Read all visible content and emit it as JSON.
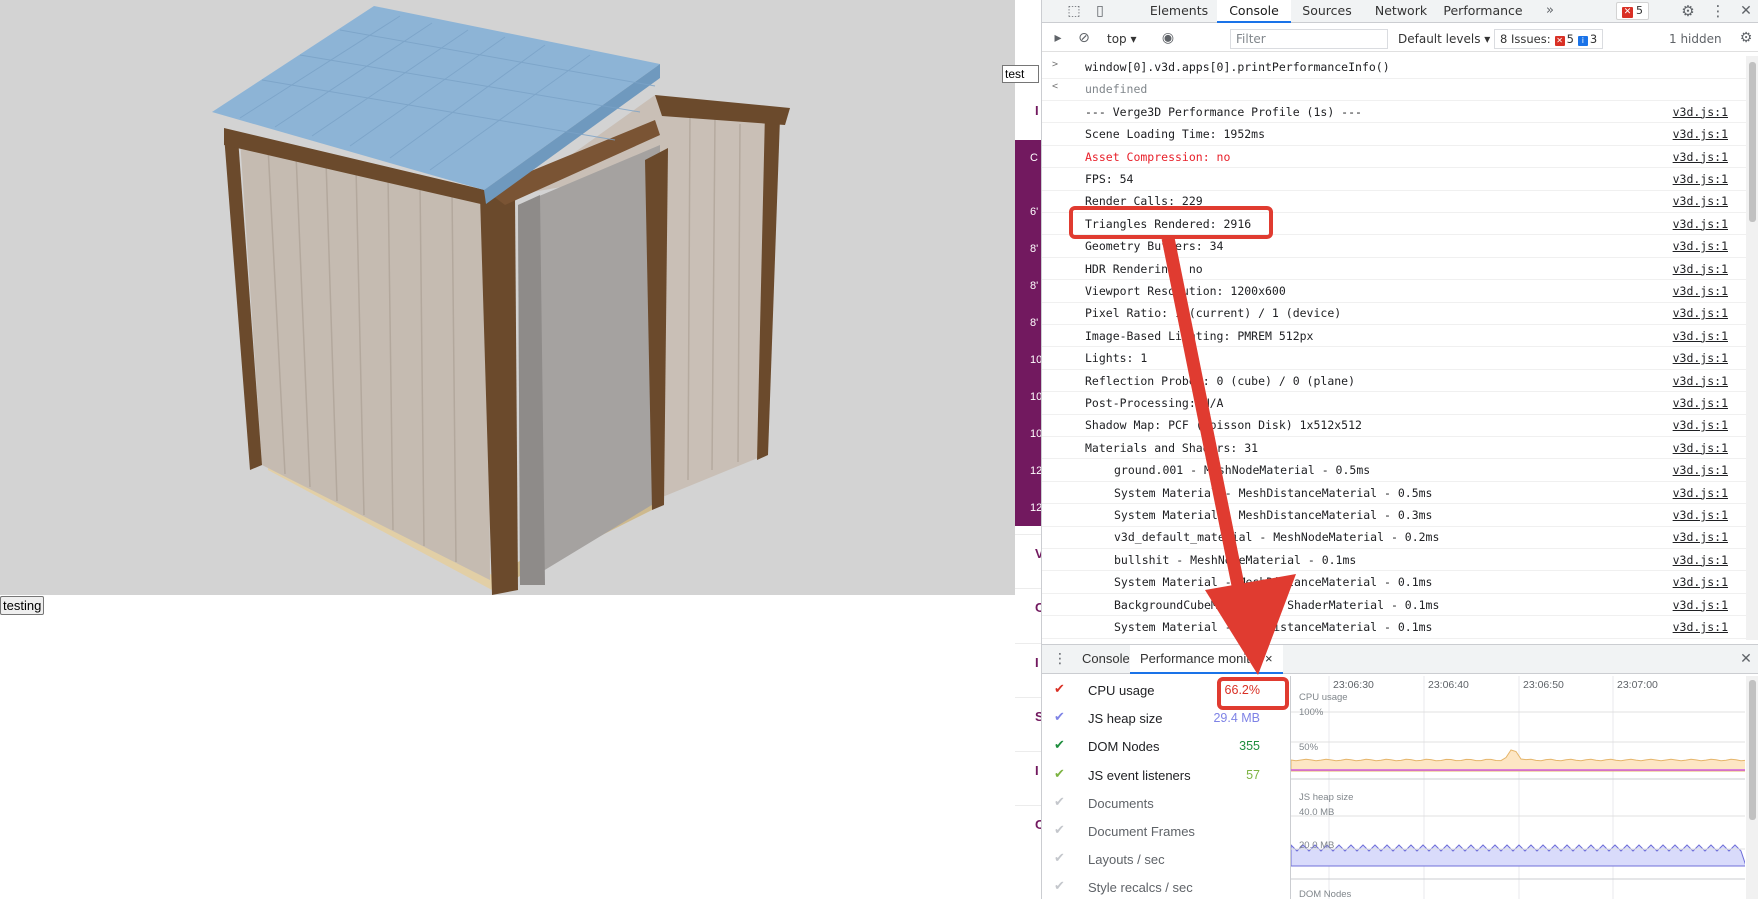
{
  "app": {
    "test_button_label": "testing",
    "side_input_value": "test",
    "side_letters": [
      "C",
      "6'",
      "8'",
      "8'",
      "8'",
      "10",
      "10",
      "10",
      "12",
      "12"
    ],
    "side_marks": [
      "I",
      "V",
      "C",
      "I",
      "S",
      "I",
      "C"
    ]
  },
  "devtools": {
    "tabs": [
      "Elements",
      "Console",
      "Sources",
      "Network",
      "Performance"
    ],
    "active_tab": "Console",
    "more_tabs_glyph": "»",
    "error_count": "5",
    "toolbar": {
      "context": "top",
      "filter_placeholder": "Filter",
      "levels": "Default levels",
      "issues_label": "8 Issues:",
      "issues_errors": "5",
      "issues_info": "3",
      "hidden": "1 hidden"
    },
    "console_lines": [
      {
        "prompt": ">",
        "text": "window[0].v3d.apps[0].printPerformanceInfo()",
        "source": "",
        "style": "input"
      },
      {
        "prompt": "<",
        "text": "undefined",
        "source": "",
        "style": "gray"
      },
      {
        "prompt": "",
        "text": "--- Verge3D Performance Profile (1s) ---",
        "source": "v3d.js:1",
        "style": ""
      },
      {
        "prompt": "",
        "text": "Scene Loading Time: 1952ms",
        "source": "v3d.js:1",
        "style": ""
      },
      {
        "prompt": "",
        "text": "Asset Compression: no",
        "source": "v3d.js:1",
        "style": "red"
      },
      {
        "prompt": "",
        "text": "FPS: 54",
        "source": "v3d.js:1",
        "style": ""
      },
      {
        "prompt": "",
        "text": "Render Calls: 229",
        "source": "v3d.js:1",
        "style": ""
      },
      {
        "prompt": "",
        "text": "Triangles Rendered: 2916",
        "source": "v3d.js:1",
        "style": ""
      },
      {
        "prompt": "",
        "text": "Geometry Buffers: 34",
        "source": "v3d.js:1",
        "style": ""
      },
      {
        "prompt": "",
        "text": "HDR Rendering: no",
        "source": "v3d.js:1",
        "style": ""
      },
      {
        "prompt": "",
        "text": "Viewport Resolution: 1200x600",
        "source": "v3d.js:1",
        "style": ""
      },
      {
        "prompt": "",
        "text": "Pixel Ratio: 1 (current) / 1 (device)",
        "source": "v3d.js:1",
        "style": ""
      },
      {
        "prompt": "",
        "text": "Image-Based Lighting: PMREM 512px",
        "source": "v3d.js:1",
        "style": ""
      },
      {
        "prompt": "",
        "text": "Lights: 1",
        "source": "v3d.js:1",
        "style": ""
      },
      {
        "prompt": "",
        "text": "Reflection Probes: 0 (cube) / 0 (plane)",
        "source": "v3d.js:1",
        "style": ""
      },
      {
        "prompt": "",
        "text": "Post-Processing: N/A",
        "source": "v3d.js:1",
        "style": ""
      },
      {
        "prompt": "",
        "text": "Shadow Map: PCF (Poisson Disk) 1x512x512",
        "source": "v3d.js:1",
        "style": ""
      },
      {
        "prompt": "",
        "text": "Materials and Shaders: 31",
        "source": "v3d.js:1",
        "style": ""
      },
      {
        "prompt": "",
        "text": "ground.001 - MeshNodeMaterial - 0.5ms",
        "source": "v3d.js:1",
        "style": "indent"
      },
      {
        "prompt": "",
        "text": "System Material - MeshDistanceMaterial - 0.5ms",
        "source": "v3d.js:1",
        "style": "indent"
      },
      {
        "prompt": "",
        "text": "System Material - MeshDistanceMaterial - 0.3ms",
        "source": "v3d.js:1",
        "style": "indent"
      },
      {
        "prompt": "",
        "text": "v3d_default_material - MeshNodeMaterial - 0.2ms",
        "source": "v3d.js:1",
        "style": "indent"
      },
      {
        "prompt": "",
        "text": "bullshit - MeshNodeMaterial - 0.1ms",
        "source": "v3d.js:1",
        "style": "indent"
      },
      {
        "prompt": "",
        "text": "System Material - MeshDistanceMaterial - 0.1ms",
        "source": "v3d.js:1",
        "style": "indent"
      },
      {
        "prompt": "",
        "text": "BackgroundCubeMaterial - ShaderMaterial - 0.1ms",
        "source": "v3d.js:1",
        "style": "indent"
      },
      {
        "prompt": "",
        "text": "System Material - MeshDistanceMaterial - 0.1ms",
        "source": "v3d.js:1",
        "style": "indent"
      }
    ],
    "drawer": {
      "tabs": [
        "Console",
        "Performance monitor"
      ],
      "active_tab": "Performance monitor",
      "close_glyph": "×"
    },
    "perf_monitor": {
      "metrics": [
        {
          "label": "CPU usage",
          "value": "66.2%",
          "enabled": true,
          "color": "#d93025"
        },
        {
          "label": "JS heap size",
          "value": "29.4 MB",
          "enabled": true,
          "color": "#7e83e6"
        },
        {
          "label": "DOM Nodes",
          "value": "355",
          "enabled": true,
          "color": "#1e8e3e"
        },
        {
          "label": "JS event listeners",
          "value": "57",
          "enabled": true,
          "color": "#7cb342"
        },
        {
          "label": "Documents",
          "value": "",
          "enabled": false,
          "color": "#9aa0a6"
        },
        {
          "label": "Document Frames",
          "value": "",
          "enabled": false,
          "color": "#9aa0a6"
        },
        {
          "label": "Layouts / sec",
          "value": "",
          "enabled": false,
          "color": "#9aa0a6"
        },
        {
          "label": "Style recalcs / sec",
          "value": "",
          "enabled": false,
          "color": "#9aa0a6"
        }
      ],
      "time_labels": [
        "23:06:30",
        "23:06:40",
        "23:06:50",
        "23:07:00"
      ],
      "cpu_chart_label": "CPU usage",
      "cpu_ticks": [
        "100%",
        "50%"
      ],
      "heap_chart_label": "JS heap size",
      "heap_ticks": [
        "40.0 MB",
        "20.0 MB"
      ],
      "dom_chart_label": "DOM Nodes"
    }
  },
  "colors": {
    "annotation_red": "#e03b30",
    "purple": "#72195f",
    "roof_blue": "#8db4d6",
    "cpu_fill": "#fde6c4",
    "heap_fill": "#d9dbfb"
  }
}
